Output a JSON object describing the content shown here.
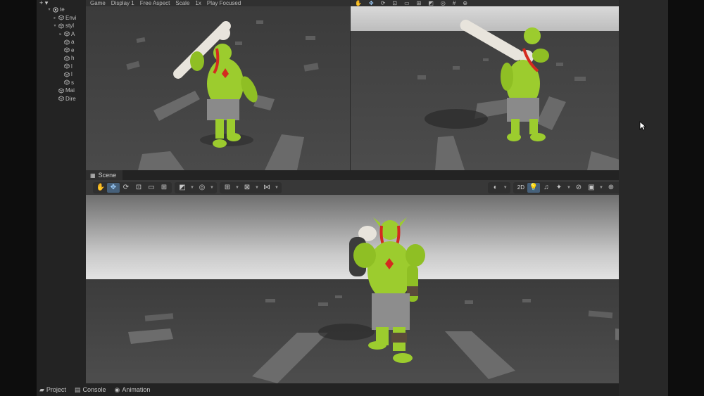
{
  "hierarchy": {
    "toolbar_plus": "+ ▾",
    "items": [
      {
        "label": "te",
        "icon": "unity-scene-icon",
        "arrow": "▾",
        "indent": 0
      },
      {
        "label": "Envi",
        "icon": "cube-icon",
        "arrow": "▸",
        "indent": 1
      },
      {
        "label": "styl",
        "icon": "cube-icon",
        "arrow": "▾",
        "indent": 1
      },
      {
        "label": "A",
        "icon": "cube-icon",
        "arrow": "▸",
        "indent": 2
      },
      {
        "label": "a",
        "icon": "cube-icon",
        "arrow": "",
        "indent": 2
      },
      {
        "label": "e",
        "icon": "cube-icon",
        "arrow": "",
        "indent": 2
      },
      {
        "label": "h",
        "icon": "cube-icon",
        "arrow": "",
        "indent": 2
      },
      {
        "label": "l",
        "icon": "cube-icon",
        "arrow": "",
        "indent": 2
      },
      {
        "label": "l",
        "icon": "cube-icon",
        "arrow": "",
        "indent": 2
      },
      {
        "label": "s",
        "icon": "cube-icon",
        "arrow": "",
        "indent": 2
      },
      {
        "label": "Mai",
        "icon": "cube-icon",
        "arrow": "",
        "indent": 1
      },
      {
        "label": "Dire",
        "icon": "cube-icon",
        "arrow": "",
        "indent": 1
      }
    ]
  },
  "game_toolbar": {
    "game_label": "Game",
    "display_label": "Display 1",
    "aspect_label": "Free Aspect",
    "scale_label": "Scale",
    "scale_value": "1x",
    "play_label": "Play Focused"
  },
  "scene": {
    "tab_label": "Scene",
    "tab_icon": "grid-icon",
    "menu_icon": "⋮",
    "toggle_2d": "2D"
  },
  "bottom_tabs": [
    {
      "label": "Project",
      "icon": "folder-icon"
    },
    {
      "label": "Console",
      "icon": "console-icon"
    },
    {
      "label": "Animation",
      "icon": "animation-icon"
    }
  ],
  "bottom_menu_icon": "⋮",
  "colors": {
    "orc_skin": "#9ccc2e",
    "orc_skin_dark": "#6f9a1a",
    "hair_red": "#d42a1f",
    "club_bone": "#e8e4dc",
    "selection_blue": "#46607a",
    "background": "#282828"
  }
}
